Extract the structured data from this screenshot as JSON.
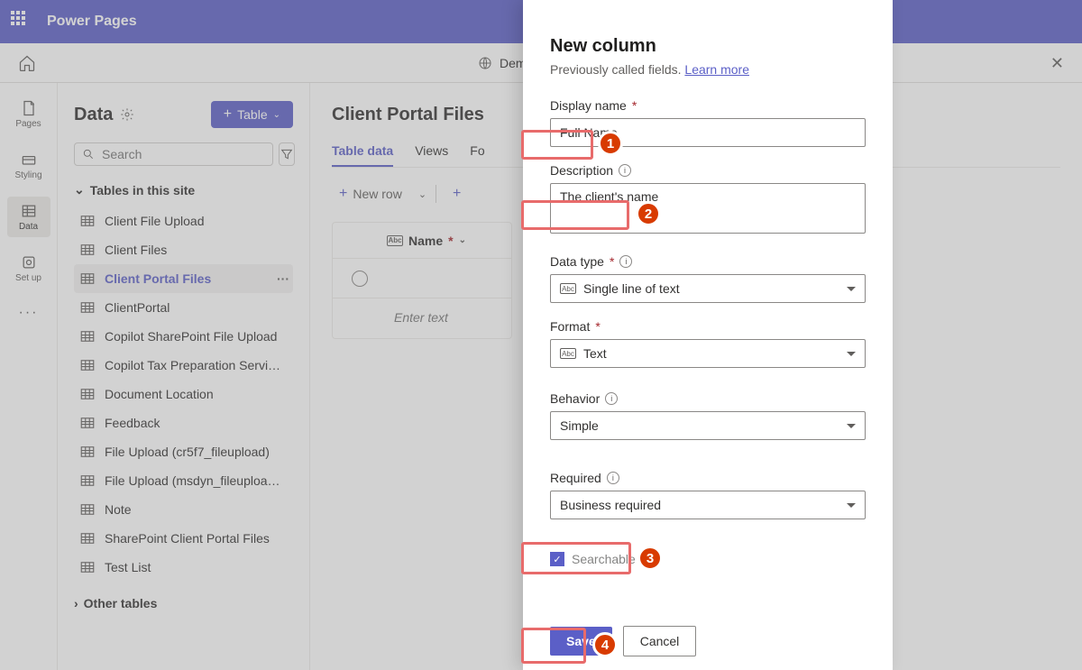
{
  "topbar": {
    "app_title": "Power Pages"
  },
  "sitebar": {
    "site_name": "Demo Site - Public"
  },
  "rail": {
    "items": [
      {
        "label": "Pages"
      },
      {
        "label": "Styling"
      },
      {
        "label": "Data"
      },
      {
        "label": "Set up"
      },
      {
        "label": ""
      }
    ]
  },
  "sidebar": {
    "title": "Data",
    "table_button": "Table",
    "search_placeholder": "Search",
    "section_title": "Tables in this site",
    "tables": [
      "Client File Upload",
      "Client Files",
      "Client Portal Files",
      "ClientPortal",
      "Copilot SharePoint File Upload",
      "Copilot Tax Preparation Servi…",
      "Document Location",
      "Feedback",
      "File Upload (cr5f7_fileupload)",
      "File Upload (msdyn_fileuploa…",
      "Note",
      "SharePoint Client Portal Files",
      "Test List"
    ],
    "active_table_index": 2,
    "other_section": "Other tables"
  },
  "content": {
    "title": "Client Portal Files",
    "tabs": [
      "Table data",
      "Views",
      "Fo"
    ],
    "active_tab_index": 0,
    "toolbar": {
      "new_row": "New row"
    },
    "grid": {
      "name_header": "Name",
      "enter_placeholder": "Enter text"
    }
  },
  "panel": {
    "title": "New column",
    "subtitle_prefix": "Previously called fields. ",
    "learn_more": "Learn more",
    "fields": {
      "display_name": {
        "label": "Display name",
        "value": "Full Name"
      },
      "description": {
        "label": "Description",
        "value": "The client's name"
      },
      "data_type": {
        "label": "Data type",
        "value": "Single line of text"
      },
      "format": {
        "label": "Format",
        "value": "Text"
      },
      "behavior": {
        "label": "Behavior",
        "value": "Simple"
      },
      "required": {
        "label": "Required",
        "value": "Business required"
      },
      "searchable": {
        "label": "Searchable",
        "checked": true
      }
    },
    "footer": {
      "save": "Save",
      "cancel": "Cancel"
    }
  },
  "callouts": [
    "1",
    "2",
    "3",
    "4"
  ]
}
